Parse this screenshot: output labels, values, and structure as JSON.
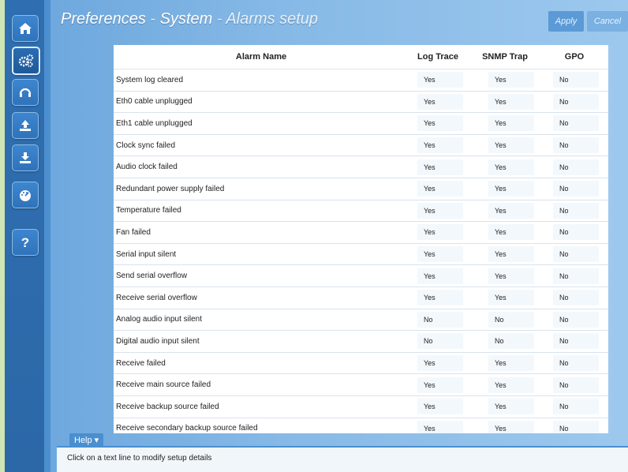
{
  "header": {
    "title_part1": "Preferences",
    "sep1": " - ",
    "title_part2": "System",
    "sep2": " - ",
    "title_part3": "Alarms setup",
    "apply_label": "Apply",
    "cancel_label": "Cancel"
  },
  "sidebar": {
    "items": [
      {
        "icon": "home-icon"
      },
      {
        "icon": "gears-icon",
        "active": true
      },
      {
        "icon": "headset-icon"
      },
      {
        "icon": "upload-icon"
      },
      {
        "icon": "download-icon"
      },
      {
        "icon": "gauge-icon"
      },
      {
        "icon": "help-icon"
      }
    ]
  },
  "table": {
    "columns": [
      "Alarm Name",
      "Log Trace",
      "SNMP Trap",
      "GPO"
    ],
    "rows": [
      [
        "System log cleared",
        "Yes",
        "Yes",
        "No"
      ],
      [
        "Eth0 cable unplugged",
        "Yes",
        "Yes",
        "No"
      ],
      [
        "Eth1 cable unplugged",
        "Yes",
        "Yes",
        "No"
      ],
      [
        "Clock sync failed",
        "Yes",
        "Yes",
        "No"
      ],
      [
        "Audio clock failed",
        "Yes",
        "Yes",
        "No"
      ],
      [
        "Redundant power supply failed",
        "Yes",
        "Yes",
        "No"
      ],
      [
        "Temperature failed",
        "Yes",
        "Yes",
        "No"
      ],
      [
        "Fan failed",
        "Yes",
        "Yes",
        "No"
      ],
      [
        "Serial input silent",
        "Yes",
        "Yes",
        "No"
      ],
      [
        "Send serial overflow",
        "Yes",
        "Yes",
        "No"
      ],
      [
        "Receive serial overflow",
        "Yes",
        "Yes",
        "No"
      ],
      [
        "Analog audio input silent",
        "No",
        "No",
        "No"
      ],
      [
        "Digital audio input silent",
        "No",
        "No",
        "No"
      ],
      [
        "Receive failed",
        "Yes",
        "Yes",
        "No"
      ],
      [
        "Receive main source failed",
        "Yes",
        "Yes",
        "No"
      ],
      [
        "Receive backup source failed",
        "Yes",
        "Yes",
        "No"
      ],
      [
        "Receive secondary backup source failed",
        "Yes",
        "Yes",
        "No"
      ]
    ]
  },
  "help": {
    "tab_label": "Help ▾",
    "text": "Click on a text line to modify setup details"
  },
  "colors": {
    "sidebar": "#2f6fb1",
    "main_bg": "#86b9e6",
    "accent": "#4a8fd0"
  }
}
